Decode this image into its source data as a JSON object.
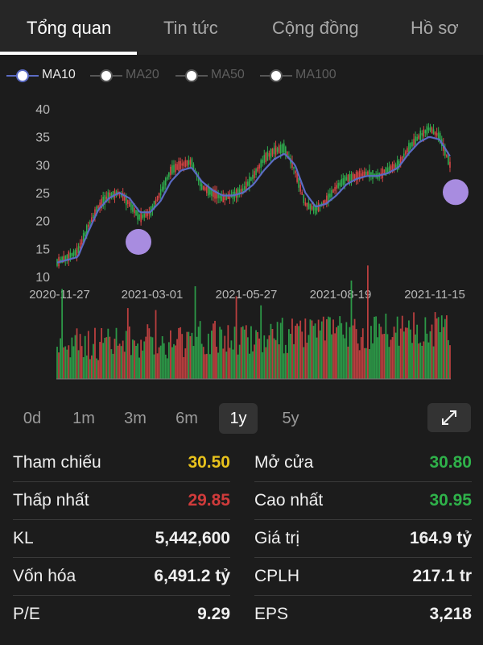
{
  "tabs": [
    {
      "label": "Tổng quan",
      "active": true
    },
    {
      "label": "Tin tức",
      "active": false
    },
    {
      "label": "Cộng đồng",
      "active": false
    },
    {
      "label": "Hồ sơ",
      "active": false
    }
  ],
  "legend": [
    {
      "label": "MA10",
      "active": true
    },
    {
      "label": "MA20",
      "active": false
    },
    {
      "label": "MA50",
      "active": false
    },
    {
      "label": "MA100",
      "active": false
    }
  ],
  "colors": {
    "up": "#2fae4f",
    "down": "#d64545",
    "ma10": "#5b6bc4",
    "ref": "#e8c21c",
    "marker": "#a88ce0"
  },
  "chart_data": {
    "type": "candlestick",
    "ylim": [
      10,
      40
    ],
    "yticks": [
      "10",
      "15",
      "20",
      "25",
      "30",
      "35",
      "40"
    ],
    "x_ticks": [
      "2020-11-27",
      "2021-03-01",
      "2021-05-27",
      "2021-08-19",
      "2021-11-15"
    ],
    "price_path": [
      12.5,
      13.5,
      14.5,
      19,
      22.5,
      24.5,
      25,
      23,
      20.5,
      21.5,
      25,
      29,
      30,
      30.5,
      26,
      25,
      24,
      24.5,
      25.5,
      28,
      31,
      32.5,
      33,
      29,
      23,
      22,
      23.5,
      26,
      27.5,
      28,
      28.5,
      28,
      29,
      30,
      33,
      35,
      36.5,
      35,
      30
    ],
    "ma10_path": [
      12.5,
      13,
      13.5,
      18,
      22,
      24,
      25,
      24,
      21.5,
      21.5,
      23.5,
      27,
      29,
      29.5,
      27,
      25.5,
      24.5,
      24.5,
      25,
      26.5,
      29,
      31,
      32,
      30,
      25,
      22.5,
      23,
      24.5,
      26.5,
      27.5,
      28,
      28,
      28.5,
      29.5,
      32,
      34,
      35,
      34.5,
      31.5
    ],
    "markers_y": [
      16.2,
      25.1
    ],
    "volume_note": "relative daily volume bars"
  },
  "ranges": [
    {
      "label": "0d",
      "active": false
    },
    {
      "label": "1m",
      "active": false
    },
    {
      "label": "3m",
      "active": false
    },
    {
      "label": "6m",
      "active": false
    },
    {
      "label": "1y",
      "active": true
    },
    {
      "label": "5y",
      "active": false
    }
  ],
  "expand_icon": "expand-diagonal-icon",
  "stats": {
    "left": [
      {
        "label": "Tham chiếu",
        "value": "30.50",
        "color": "#e8c21c"
      },
      {
        "label": "Thấp nhất",
        "value": "29.85",
        "color": "#d03b3b"
      },
      {
        "label": "KL",
        "value": "5,442,600",
        "color": "#efefef"
      },
      {
        "label": "Vốn hóa",
        "value": "6,491.2 tỷ",
        "color": "#efefef"
      },
      {
        "label": "P/E",
        "value": "9.29",
        "color": "#efefef"
      }
    ],
    "right": [
      {
        "label": "Mở cửa",
        "value": "30.80",
        "color": "#2fb24a"
      },
      {
        "label": "Cao nhất",
        "value": "30.95",
        "color": "#2fb24a"
      },
      {
        "label": "Giá trị",
        "value": "164.9 tỷ",
        "color": "#efefef"
      },
      {
        "label": "CPLH",
        "value": "217.1 tr",
        "color": "#efefef"
      },
      {
        "label": "EPS",
        "value": "3,218",
        "color": "#efefef"
      }
    ]
  }
}
